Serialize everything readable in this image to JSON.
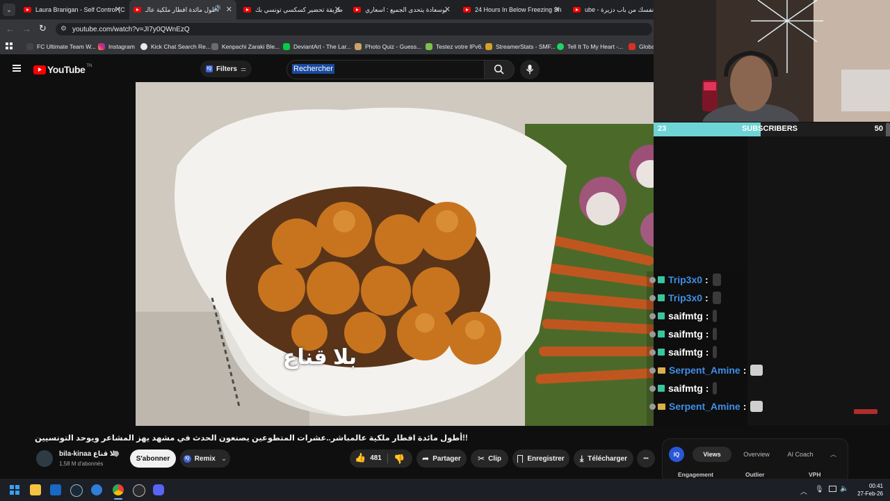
{
  "browser": {
    "tabs": [
      {
        "title": "Laura Branigan - Self Control (C",
        "active": false
      },
      {
        "title": "أطول مائدة افطار ملكية عالـ",
        "active": true
      },
      {
        "title": "طريقة تحضير كسكسي تونسي بك",
        "active": false
      },
      {
        "title": "بوسعادة يتحدى الجميع : اسعاري",
        "active": false
      },
      {
        "title": "24 Hours In Below Freezing Sn",
        "active": false
      },
      {
        "title": "ك نفسك من باب دزيرة - ube",
        "active": false
      }
    ],
    "url": "youtube.com/watch?v=JI7y0QWnEzQ",
    "bookmarks": [
      "FC Ultimate Team W...",
      "Instagram",
      "Kick Chat Search Re...",
      "Kenpachi Zaraki Ble...",
      "DeviantArt - The Lar...",
      "Photo Quiz - Guess...",
      "Testez votre IPv6.",
      "StreamerStats - SMF...",
      "Tell It To My Heart -...",
      "Globa"
    ]
  },
  "youtube": {
    "logo_text": "YouTube",
    "country_code": "TN",
    "filters_label": "Filters",
    "search_placeholder": "Rechercher",
    "video_caption": "بلا قناع",
    "video_title": "!!أطول مائدة افطار ملكية عالمباشر..عشرات المتطوعين يصنعون الحدث في مشهد يهز المشاعر ويوحد التونسيين",
    "channel": {
      "name": "bila-kinaa بلا قناع",
      "subscribers": "1,58 M d'abonnés"
    },
    "subscribe_label": "S'abonner",
    "remix_label": "Remix",
    "like_count": "481",
    "share_label": "Partager",
    "clip_label": "Clip",
    "save_label": "Enregistrer",
    "download_label": "Télécharger",
    "more_label": "•••"
  },
  "iq_panel": {
    "logo": "IQ",
    "tabs": [
      "Views",
      "Overview",
      "AI Coach"
    ],
    "active_tab": "Views",
    "columns": [
      "Engagement",
      "Outlier",
      "VPH"
    ]
  },
  "stream_overlay": {
    "sub_goal": {
      "current": "23",
      "label": "SUBSCRIBERS",
      "goal": "50",
      "progress": 0.46
    },
    "chat": [
      {
        "user": "Trip3x0",
        "color": "#3f8fe8"
      },
      {
        "user": "Trip3x0",
        "color": "#3f8fe8"
      },
      {
        "user": "saifmtg",
        "color": "#ffffff"
      },
      {
        "user": "saifmtg",
        "color": "#ffffff"
      },
      {
        "user": "saifmtg",
        "color": "#ffffff"
      },
      {
        "user": "Serpent_Amine",
        "color": "#3f8fe8"
      },
      {
        "user": "saifmtg",
        "color": "#ffffff"
      },
      {
        "user": "Serpent_Amine",
        "color": "#3f8fe8"
      }
    ]
  },
  "taskbar": {
    "time": "00:41",
    "date": "27-Feb-26"
  },
  "colors": {
    "youtube_red": "#ff0000",
    "background": "#0f0f0f",
    "sub_bar_fill": "#6fd4d6",
    "chat_blue": "#3f8fe8"
  }
}
